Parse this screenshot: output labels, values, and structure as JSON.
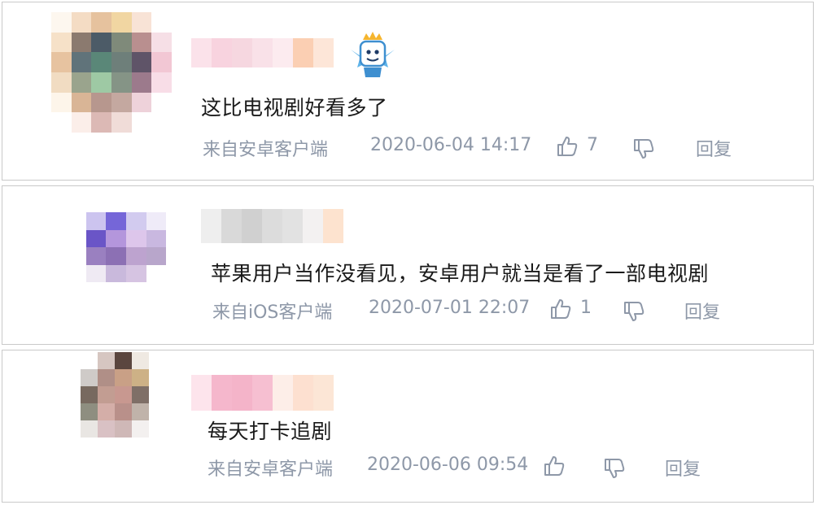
{
  "comments": [
    {
      "text": "这比电视剧好看多了",
      "source": "来自安卓客户端",
      "time": "2020-06-04 14:17",
      "likes": "7",
      "reply_label": "回复",
      "badge_icon": "crowned-mascot-badge-icon"
    },
    {
      "text": "苹果用户当作没看见，安卓用户就当是看了一部电视剧",
      "source": "来自iOS客户端",
      "time": "2020-07-01 22:07",
      "likes": "1",
      "reply_label": "回复"
    },
    {
      "text": "每天打卡追剧",
      "source": "来自安卓客户端",
      "time": "2020-06-06 09:54",
      "likes": "",
      "reply_label": "回复"
    }
  ],
  "colors": {
    "meta_text": "#8e98a8",
    "comment_text": "#1a1a1a",
    "card_border": "#c9c9c9"
  }
}
